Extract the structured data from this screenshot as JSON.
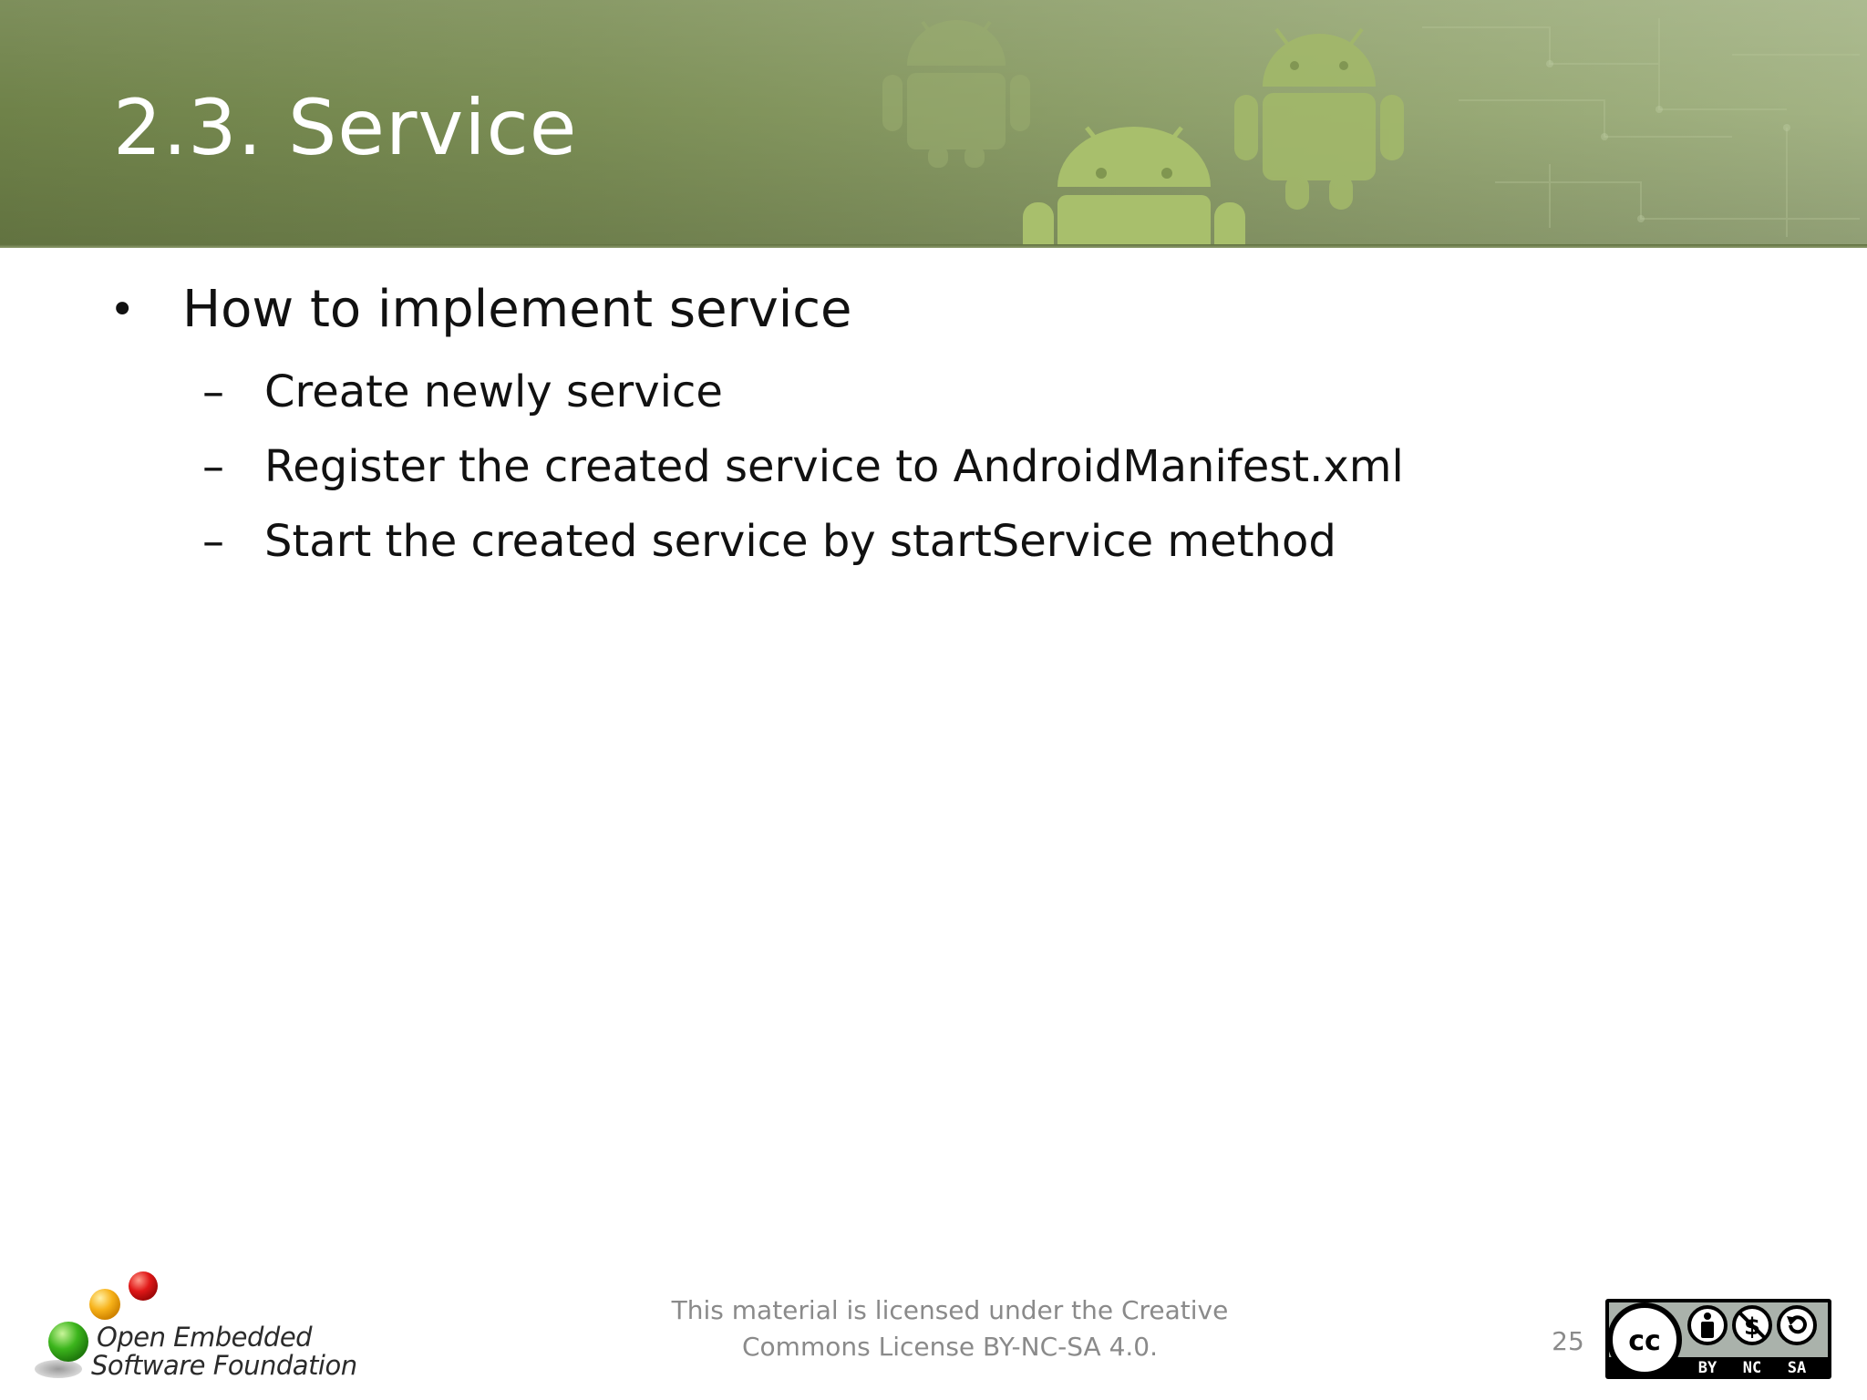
{
  "slide": {
    "title": "2.3. Service",
    "bullets": [
      {
        "marker": "•",
        "text": "How to implement service",
        "sub": [
          {
            "marker": "–",
            "text": "Create newly service"
          },
          {
            "marker": "–",
            "text": "Register the created service to AndroidManifest.xml"
          },
          {
            "marker": "–",
            "text": "Start the created service by startService method"
          }
        ]
      }
    ]
  },
  "footer": {
    "logo": {
      "line1": "Open Embedded",
      "line2": "Software Foundation"
    },
    "license_line1": "This material is licensed under the Creative",
    "license_line2": "Commons License BY-NC-SA 4.0.",
    "page_number": "25",
    "cc_badge": {
      "labels": [
        "BY",
        "NC",
        "SA"
      ]
    }
  },
  "colors": {
    "banner": "#7b8e55",
    "title_text": "#ffffff",
    "body_text": "#111111",
    "footer_text": "#8a8a8a"
  }
}
